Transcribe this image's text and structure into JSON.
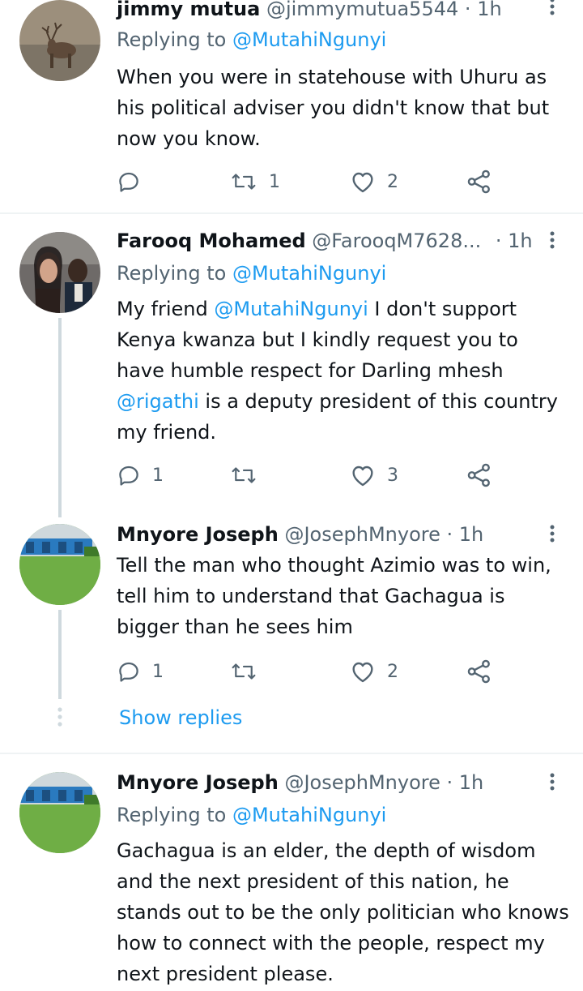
{
  "colors": {
    "accent": "#1d9bf0",
    "muted": "#536471",
    "text": "#0f1419",
    "divider": "#eff3f4",
    "thread": "#cfd9de"
  },
  "tweets": [
    {
      "name": "jimmy mutua",
      "handle": "@jimmymutua5544",
      "dot": "·",
      "time": "1h",
      "replying_label": "Replying to",
      "replying_to": "@MutahiNgunyi",
      "text": "When you were in statehouse with Uhuru as his political adviser you didn't know that but now you know.",
      "replies": "",
      "retweets": "1",
      "likes": "2",
      "avatar_icon": "deer-avatar"
    },
    {
      "name": "Farooq Mohamed",
      "handle": "@FarooqM7628...",
      "dot": "·",
      "time": "1h",
      "replying_label": "Replying to",
      "replying_to": "@MutahiNgunyi",
      "text_parts": [
        "My friend ",
        "@MutahiNgunyi",
        " I don't support Kenya kwanza but I kindly request you to have humble respect for Darling mhesh ",
        "@rigathi",
        " is a deputy president of this country my friend."
      ],
      "replies": "1",
      "retweets": "",
      "likes": "3",
      "avatar_icon": "couple-photo-avatar"
    },
    {
      "name": "Mnyore Joseph",
      "handle": "@JosephMnyore",
      "dot": "·",
      "time": "1h",
      "text": "Tell the man who thought Azimio was to win, tell him to understand that Gachagua is bigger than he sees him",
      "replies": "1",
      "retweets": "",
      "likes": "2",
      "avatar_icon": "grass-field-avatar"
    },
    {
      "name": "Mnyore Joseph",
      "handle": "@JosephMnyore",
      "dot": "·",
      "time": "1h",
      "replying_label": "Replying to",
      "replying_to": "@MutahiNgunyi",
      "text": "Gachagua is an elder, the depth of wisdom and the next president of this nation, he stands out to be the only politician who knows how to connect with the people, respect my next president please.",
      "avatar_icon": "grass-field-avatar"
    }
  ],
  "show_replies_label": "Show replies"
}
